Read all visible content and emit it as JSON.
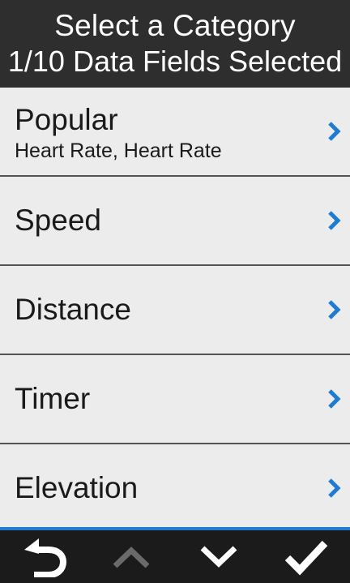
{
  "header": {
    "title": "Select a Category",
    "subtitle": "1/10 Data Fields Selected"
  },
  "categories": [
    {
      "label": "Popular",
      "sublabel": "Heart Rate, Heart Rate"
    },
    {
      "label": "Speed"
    },
    {
      "label": "Distance"
    },
    {
      "label": "Timer"
    },
    {
      "label": "Elevation"
    }
  ],
  "icons": {
    "row_chevron": "chevron-right-icon",
    "back": "back-arrow-icon",
    "scroll_up": "chevron-up-icon",
    "scroll_down": "chevron-down-icon",
    "confirm": "checkmark-icon"
  },
  "colors": {
    "header_bg": "#2e2e2e",
    "list_bg": "#ececec",
    "accent": "#1f7ad1",
    "footer_bg": "#1b1b1b",
    "disabled_icon": "#6a6a6a"
  }
}
